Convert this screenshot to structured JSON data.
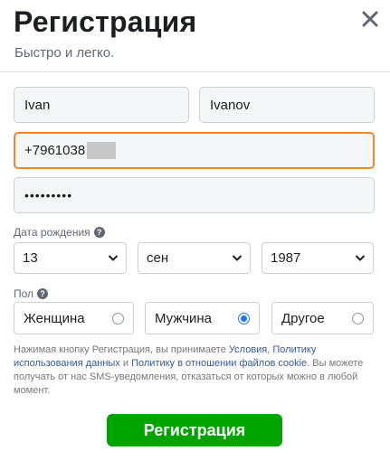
{
  "header": {
    "title": "Регистрация",
    "subtitle": "Быстро и легко."
  },
  "form": {
    "first_name": "Ivan",
    "last_name": "Ivanov",
    "phone": "+7961038",
    "password": "•••••••••"
  },
  "birthday": {
    "label": "Дата рождения",
    "day": "13",
    "month": "сен",
    "year": "1987"
  },
  "gender": {
    "label": "Пол",
    "options": [
      "Женщина",
      "Мужчина",
      "Другое"
    ],
    "selected": "Мужчина"
  },
  "terms": {
    "t1": "Нажимая кнопку Регистрация, вы принимаете ",
    "link_terms": "Условия",
    "t2": ", ",
    "link_data_policy": "Политику использования данных",
    "t3": " и ",
    "link_cookie_policy": "Политику в отношении файлов cookie",
    "t4": ". Вы можете получать от нас SMS-уведомления, отказаться от которых можно в любой момент."
  },
  "submit_label": "Регистрация",
  "colors": {
    "accent_focus": "#ec8a25",
    "submit_green": "#00a400",
    "link": "#385898",
    "radio_checked": "#1877f2"
  },
  "icons": {
    "close": "close-icon",
    "help": "question-circle-icon",
    "dropdown": "chevron-down-icon"
  }
}
